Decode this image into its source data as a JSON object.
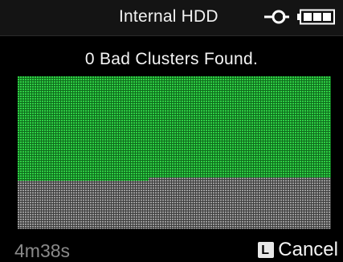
{
  "header": {
    "title": "Internal HDD",
    "power_icon": "power-plug-icon",
    "battery_icon": "battery-full-icon",
    "battery_level": 1.0
  },
  "status": {
    "message": "0 Bad Clusters Found."
  },
  "scan_progress": {
    "fraction_scanned": 0.7,
    "scanned_color": "#22c33a",
    "unscanned_color": "#8c8c8c"
  },
  "footer": {
    "elapsed": "4m38s",
    "cancel_key_glyph": "L",
    "cancel_label": "Cancel"
  }
}
